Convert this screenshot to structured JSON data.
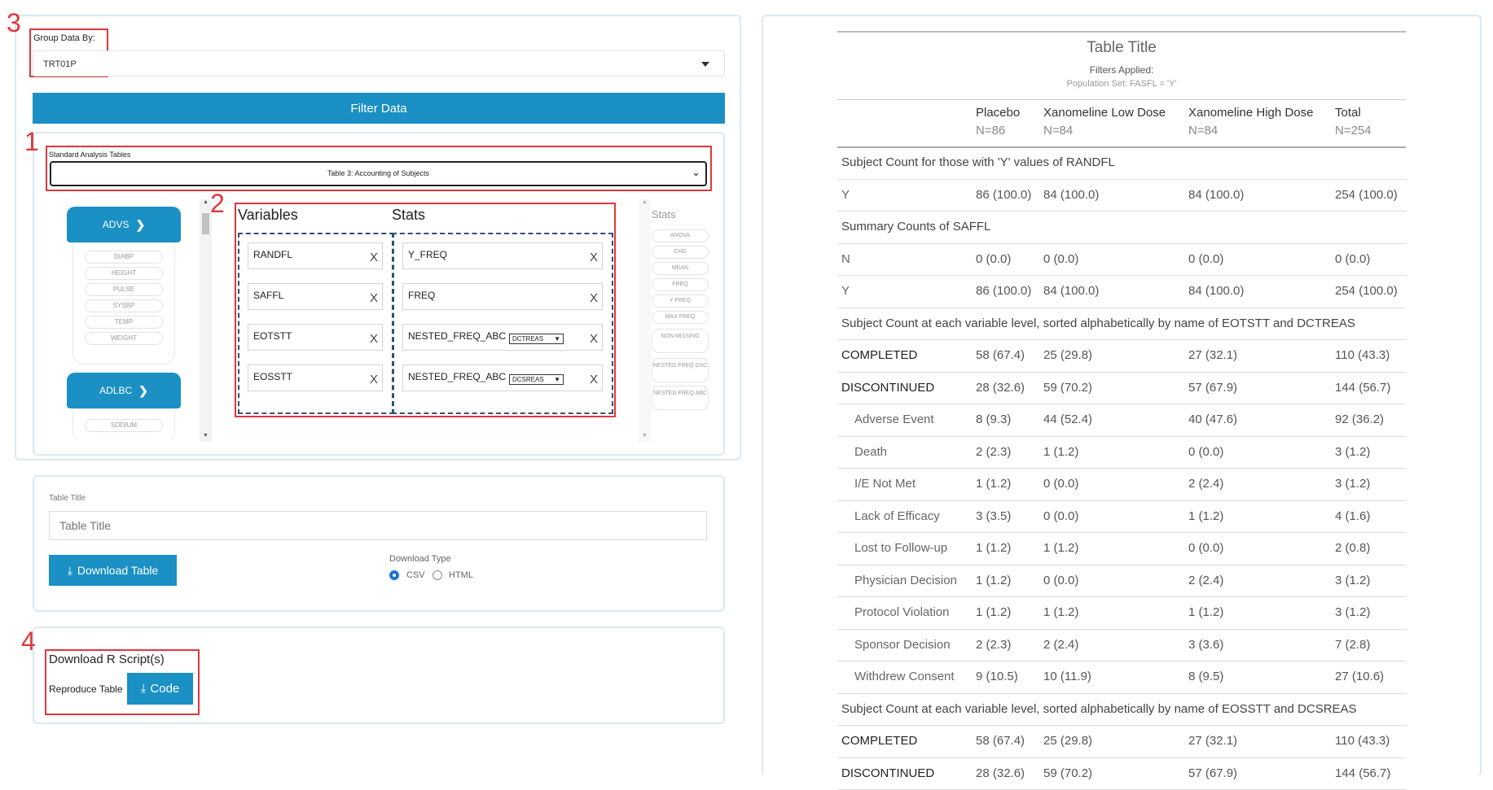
{
  "annotations": {
    "n1": "1",
    "n2": "2",
    "n3": "3",
    "n4": "4"
  },
  "group_by": {
    "label": "Group Data By:",
    "value": "TRT01P"
  },
  "filter_button": "Filter Data",
  "analysis": {
    "label": "Standard Analysis Tables",
    "selected": "Table 3: Accounting of Subjects"
  },
  "sidebar": {
    "adsl_header": "ADVS",
    "adsl_items": [
      "DIABP",
      "HEIGHT",
      "PULSE",
      "SYSBP",
      "TEMP",
      "WEIGHT"
    ],
    "adlb_header": "ADLBC",
    "adlb_items": [
      "SODIUM"
    ]
  },
  "dropzone": {
    "variables_title": "Variables",
    "stats_title": "Stats",
    "variables": [
      "RANDFL",
      "SAFFL",
      "EOTSTT",
      "EOSSTT"
    ],
    "stats": [
      "Y_FREQ",
      "FREQ",
      "NESTED_FREQ_ABC",
      "NESTED_FREQ_ABC"
    ],
    "nested_selects": [
      "DCTREAS",
      "DCSREAS"
    ],
    "remove": "X"
  },
  "stats_panel": {
    "title": "Stats",
    "items": [
      "ANOVA",
      "CHG",
      "MEAN",
      "FREQ",
      "Y FREQ",
      "MAX FREQ",
      "NON MISSING",
      "NESTED FREQ DSC",
      "NESTED FREQ ABC"
    ]
  },
  "title_panel": {
    "label": "Table Title",
    "placeholder": "Table Title",
    "download_button": "Download Table",
    "download_type_label": "Download Type",
    "options": [
      "CSV",
      "HTML"
    ]
  },
  "script_panel": {
    "title": "Download R Script(s)",
    "reproduce_label": "Reproduce Table",
    "code_button": "Code"
  },
  "table": {
    "title": "Table Title",
    "filters_label": "Filters Applied:",
    "population": "Population Set: FASFL = 'Y'",
    "columns": [
      {
        "name": "Placebo",
        "n": "N=86"
      },
      {
        "name": "Xanomeline Low Dose",
        "n": "N=84"
      },
      {
        "name": "Xanomeline High Dose",
        "n": "N=84"
      },
      {
        "name": "Total",
        "n": "N=254"
      }
    ],
    "rows": [
      {
        "type": "section",
        "label": "Subject Count for those with 'Y' values of RANDFL"
      },
      {
        "type": "row",
        "label": "Y",
        "cells": [
          "86 (100.0)",
          "84 (100.0)",
          "84 (100.0)",
          "254 (100.0)"
        ]
      },
      {
        "type": "section",
        "label": "Summary Counts of SAFFL"
      },
      {
        "type": "row",
        "label": "N",
        "cells": [
          "0 (0.0)",
          "0 (0.0)",
          "0 (0.0)",
          "0 (0.0)"
        ]
      },
      {
        "type": "row",
        "label": "Y",
        "cells": [
          "86 (100.0)",
          "84 (100.0)",
          "84 (100.0)",
          "254 (100.0)"
        ]
      },
      {
        "type": "section",
        "label": "Subject Count at each variable level, sorted alphabetically by name of EOTSTT and DCTREAS"
      },
      {
        "type": "bold",
        "label": "COMPLETED",
        "cells": [
          "58 (67.4)",
          "25 (29.8)",
          "27 (32.1)",
          "110 (43.3)"
        ]
      },
      {
        "type": "bold",
        "label": "DISCONTINUED",
        "cells": [
          "28 (32.6)",
          "59 (70.2)",
          "57 (67.9)",
          "144 (56.7)"
        ]
      },
      {
        "type": "sub",
        "label": "Adverse Event",
        "cells": [
          "8 (9.3)",
          "44 (52.4)",
          "40 (47.6)",
          "92 (36.2)"
        ]
      },
      {
        "type": "sub",
        "label": "Death",
        "cells": [
          "2 (2.3)",
          "1 (1.2)",
          "0 (0.0)",
          "3 (1.2)"
        ]
      },
      {
        "type": "sub",
        "label": "I/E Not Met",
        "cells": [
          "1 (1.2)",
          "0 (0.0)",
          "2 (2.4)",
          "3 (1.2)"
        ]
      },
      {
        "type": "sub",
        "label": "Lack of Efficacy",
        "cells": [
          "3 (3.5)",
          "0 (0.0)",
          "1 (1.2)",
          "4 (1.6)"
        ]
      },
      {
        "type": "sub",
        "label": "Lost to Follow-up",
        "cells": [
          "1 (1.2)",
          "1 (1.2)",
          "0 (0.0)",
          "2 (0.8)"
        ]
      },
      {
        "type": "sub",
        "label": "Physician Decision",
        "cells": [
          "1 (1.2)",
          "0 (0.0)",
          "2 (2.4)",
          "3 (1.2)"
        ]
      },
      {
        "type": "sub",
        "label": "Protocol Violation",
        "cells": [
          "1 (1.2)",
          "1 (1.2)",
          "1 (1.2)",
          "3 (1.2)"
        ]
      },
      {
        "type": "sub",
        "label": "Sponsor Decision",
        "cells": [
          "2 (2.3)",
          "2 (2.4)",
          "3 (3.6)",
          "7 (2.8)"
        ]
      },
      {
        "type": "sub",
        "label": "Withdrew Consent",
        "cells": [
          "9 (10.5)",
          "10 (11.9)",
          "8 (9.5)",
          "27 (10.6)"
        ]
      },
      {
        "type": "section",
        "label": "Subject Count at each variable level, sorted alphabetically by name of EOSSTT and DCSREAS"
      },
      {
        "type": "bold",
        "label": "COMPLETED",
        "cells": [
          "58 (67.4)",
          "25 (29.8)",
          "27 (32.1)",
          "110 (43.3)"
        ]
      },
      {
        "type": "bold",
        "label": "DISCONTINUED",
        "cells": [
          "28 (32.6)",
          "59 (70.2)",
          "57 (67.9)",
          "144 (56.7)"
        ]
      }
    ]
  }
}
